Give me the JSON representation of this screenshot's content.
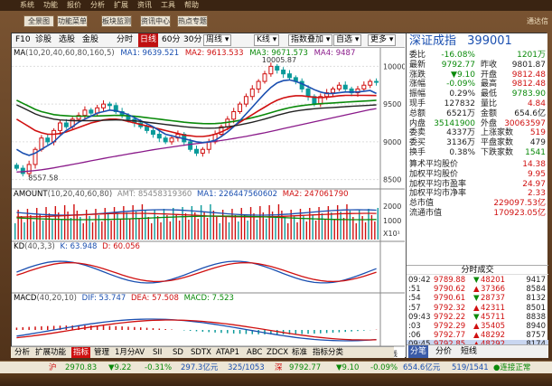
{
  "app": {
    "topbar": [
      "系统",
      "功能",
      "报价",
      "分析",
      "扩展",
      "资讯",
      "工具",
      "帮助"
    ],
    "brand": "通达信",
    "menu_buttons": [
      "全景图",
      "功能菜单",
      "板块监测",
      "资讯中心",
      "热点专题"
    ]
  },
  "toolbar": {
    "items": [
      "F10",
      "诊股",
      "选股",
      "金股",
      "分时",
      "日线",
      "60分",
      "30分",
      "周线",
      "K线",
      "指数叠加",
      "自选",
      "更多"
    ],
    "active": "日线"
  },
  "main_legend": {
    "ma_label": "MA",
    "ma_params": "(10,20,40,60,80,160,5)",
    "ma1": "MA1: 9639.521",
    "ma2": "MA2: 9613.533",
    "ma3": "MA3: 9671.573",
    "ma4": "MA4: 9487"
  },
  "main_chart": {
    "y_ticks": [
      "10000",
      "9500",
      "9000",
      "8500"
    ],
    "high_label": "10005.87",
    "low_label": "8557.58"
  },
  "amount_legend": {
    "label": "AMOUNT",
    "params": "(10,20,40,60,80)",
    "amo": "AMT: 85458319360",
    "ma1": "MA1: 226447560602",
    "ma2": "MA2: 247061790"
  },
  "amount_chart": {
    "y_ticks": [
      "2000",
      "1000",
      "X10¹"
    ]
  },
  "kd_legend": {
    "label": "KD",
    "params": "(40,3,3)",
    "k": "K: 63.948",
    "d": "D: 60.056"
  },
  "macd_legend": {
    "label": "MACD",
    "params": "(40,20,10)",
    "dif": "DIF: 53.747",
    "dea": "DEA: 57.508",
    "macd": "MACD: 7.523"
  },
  "x_axis": {
    "labels": [
      "2019/5/8",
      "7",
      "8",
      "9",
      "10"
    ],
    "end_label": "日线"
  },
  "quote": {
    "name": "深证成指",
    "code": "399001",
    "rows": [
      {
        "l1": "委比",
        "v1": "-16.08%",
        "l2": "",
        "v2": "1201万",
        "c1": "green",
        "c2": "green"
      },
      {
        "l1": "最新",
        "v1": "9792.77",
        "l2": "昨收",
        "v2": "9801.87",
        "c1": "green",
        "c2": "dark"
      },
      {
        "l1": "涨跌",
        "v1": "▼9.10",
        "l2": "开盘",
        "v2": "9812.48",
        "c1": "green",
        "c2": "red"
      },
      {
        "l1": "涨幅",
        "v1": "-0.09%",
        "l2": "最高",
        "v2": "9812.48",
        "c1": "green",
        "c2": "red"
      },
      {
        "l1": "振幅",
        "v1": "0.29%",
        "l2": "最低",
        "v2": "9783.90",
        "c1": "dark",
        "c2": "green"
      },
      {
        "l1": "现手",
        "v1": "127832",
        "l2": "量比",
        "v2": "4.84",
        "c1": "dark",
        "c2": "red"
      },
      {
        "l1": "总额",
        "v1": "6521万",
        "l2": "金额",
        "v2": "654.6亿",
        "c1": "dark",
        "c2": "dark"
      },
      {
        "l1": "内盘",
        "v1": "35141900",
        "l2": "外盘",
        "v2": "30063597",
        "c1": "green",
        "c2": "red"
      },
      {
        "l1": "委卖",
        "v1": "4337万",
        "l2": "上涨家数",
        "v2": "519",
        "c1": "dark",
        "c2": "red"
      },
      {
        "l1": "委买",
        "v1": "3136万",
        "l2": "平盘家数",
        "v2": "479",
        "c1": "dark",
        "c2": "dark"
      },
      {
        "l1": "换手",
        "v1": "0.38%",
        "l2": "下跌家数",
        "v2": "1541",
        "c1": "dark",
        "c2": "green"
      }
    ],
    "stats": [
      {
        "l": "算术平均股价",
        "v": "14.38",
        "c": "red"
      },
      {
        "l": "加权平均股价",
        "v": "9.95",
        "c": "red"
      },
      {
        "l": "加权平均市盈率",
        "v": "24.97",
        "c": "red"
      },
      {
        "l": "加权平均市净率",
        "v": "2.33",
        "c": "red"
      },
      {
        "l": "总市值",
        "v": "229097.53亿",
        "c": "red"
      },
      {
        "l": "流通市值",
        "v": "170923.05亿",
        "c": "red"
      }
    ],
    "ticks_header": "分时成交",
    "ticks": [
      {
        "t": "09:42",
        "p": "9789.88",
        "dir": "▼",
        "v": "48201",
        "n": "9417"
      },
      {
        "t": ":51",
        "p": "9790.62",
        "dir": "▲",
        "v": "37366",
        "n": "8584"
      },
      {
        "t": ":54",
        "p": "9790.61",
        "dir": "▼",
        "v": "28737",
        "n": "8132"
      },
      {
        "t": ":57",
        "p": "9792.32",
        "dir": "▲",
        "v": "42311",
        "n": "8501"
      },
      {
        "t": "09:43",
        "p": "9792.22",
        "dir": "▼",
        "v": "45711",
        "n": "8838"
      },
      {
        "t": ":03",
        "p": "9792.29",
        "dir": "▲",
        "v": "35405",
        "n": "8940"
      },
      {
        "t": ":06",
        "p": "9792.77",
        "dir": "▲",
        "v": "48292",
        "n": "8757"
      },
      {
        "t": "09:45",
        "p": "9792.85",
        "dir": "▲",
        "v": "48292",
        "n": "8174"
      }
    ],
    "tabs": [
      "分笔",
      "分价",
      "短线"
    ]
  },
  "bottom_tabs": [
    "分析",
    "扩展功能",
    "指标",
    "管理",
    "1月分",
    "AV",
    "SII",
    "SD",
    "SDTX",
    "ATAP1",
    "ABC",
    "ZDCX",
    "标准",
    "指标分类"
  ],
  "bottom_active": "指标",
  "status": {
    "sh_label": "沪",
    "sh_price": "2970.83",
    "sh_chg": "▼9.22",
    "sh_pct": "-0.31%",
    "sh_amt": "297.3亿元",
    "sh_cnt": "325/1053",
    "sz_label": "深",
    "sz_price": "9792.77",
    "sz_chg": "▼9.10",
    "sz_pct": "-0.09%",
    "sz_amt": "654.6亿元",
    "sz_cnt": "519/1541",
    "conn": "连接正常"
  },
  "chart_data": [
    {
      "type": "line",
      "title": "",
      "series_note": "daily candlesticks with moving averages",
      "ylim": [
        8400,
        10100
      ],
      "candles_close": [
        8650,
        8580,
        8700,
        8900,
        9050,
        9000,
        9150,
        9250,
        9200,
        9300,
        9350,
        9420,
        9380,
        9450,
        9500,
        9480,
        9400,
        9350,
        9300,
        9250,
        9200,
        9150,
        9100,
        9050,
        9000,
        9050,
        9100,
        9000,
        8900,
        8850,
        8900,
        9000,
        9100,
        9200,
        9300,
        9400,
        9500,
        9600,
        9700,
        9800,
        9900,
        10000,
        9950,
        9900,
        9850,
        9800,
        9700,
        9600,
        9500,
        9600,
        9650,
        9700,
        9750,
        9700,
        9650,
        9700,
        9750,
        9800,
        9790
      ],
      "ma1": [
        8900,
        8850,
        8820,
        8850,
        8900,
        8950,
        9000,
        9080,
        9150,
        9200,
        9260,
        9300,
        9340,
        9380,
        9400,
        9420,
        9410,
        9390,
        9360,
        9320,
        9280,
        9240,
        9200,
        9150,
        9100,
        9080,
        9060,
        9040,
        9020,
        9000,
        8990,
        9000,
        9020,
        9070,
        9130,
        9200,
        9280,
        9370,
        9460,
        9550,
        9640,
        9720,
        9780,
        9810,
        9820,
        9800,
        9770,
        9730,
        9690,
        9660,
        9640,
        9640,
        9650,
        9660,
        9660,
        9660,
        9670,
        9680,
        9640
      ],
      "ma2": [
        9300,
        9250,
        9200,
        9150,
        9120,
        9100,
        9100,
        9110,
        9130,
        9160,
        9190,
        9220,
        9250,
        9270,
        9290,
        9300,
        9300,
        9290,
        9270,
        9250,
        9230,
        9210,
        9190,
        9170,
        9150,
        9130,
        9110,
        9090,
        9080,
        9070,
        9070,
        9080,
        9100,
        9130,
        9170,
        9210,
        9260,
        9310,
        9360,
        9410,
        9460,
        9510,
        9550,
        9580,
        9600,
        9610,
        9610,
        9600,
        9590,
        9585,
        9590,
        9600,
        9610,
        9615,
        9615,
        9615,
        9615,
        9614,
        9613
      ],
      "ma3": [
        9550,
        9510,
        9470,
        9430,
        9400,
        9380,
        9360,
        9350,
        9345,
        9340,
        9340,
        9340,
        9340,
        9342,
        9345,
        9348,
        9350,
        9348,
        9344,
        9338,
        9330,
        9320,
        9310,
        9300,
        9290,
        9280,
        9270,
        9260,
        9252,
        9246,
        9242,
        9240,
        9242,
        9248,
        9258,
        9270,
        9285,
        9302,
        9320,
        9340,
        9362,
        9386,
        9410,
        9432,
        9452,
        9468,
        9480,
        9490,
        9498,
        9505,
        9510,
        9515,
        9520,
        9525,
        9530,
        9535,
        9540,
        9545,
        9550
      ],
      "ma4": [
        8600,
        8605,
        8612,
        8620,
        8630,
        8642,
        8655,
        8670,
        8685,
        8700,
        8716,
        8732,
        8748,
        8764,
        8780,
        8795,
        8810,
        8824,
        8838,
        8852,
        8866,
        8880,
        8894,
        8908,
        8920,
        8932,
        8944,
        8956,
        8966,
        8976,
        8986,
        8996,
        9006,
        9018,
        9030,
        9044,
        9058,
        9072,
        9088,
        9104,
        9120,
        9138,
        9156,
        9174,
        9192,
        9210,
        9228,
        9246,
        9264,
        9282,
        9300,
        9318,
        9336,
        9354,
        9372,
        9390,
        9408,
        9426,
        9440
      ]
    }
  ]
}
